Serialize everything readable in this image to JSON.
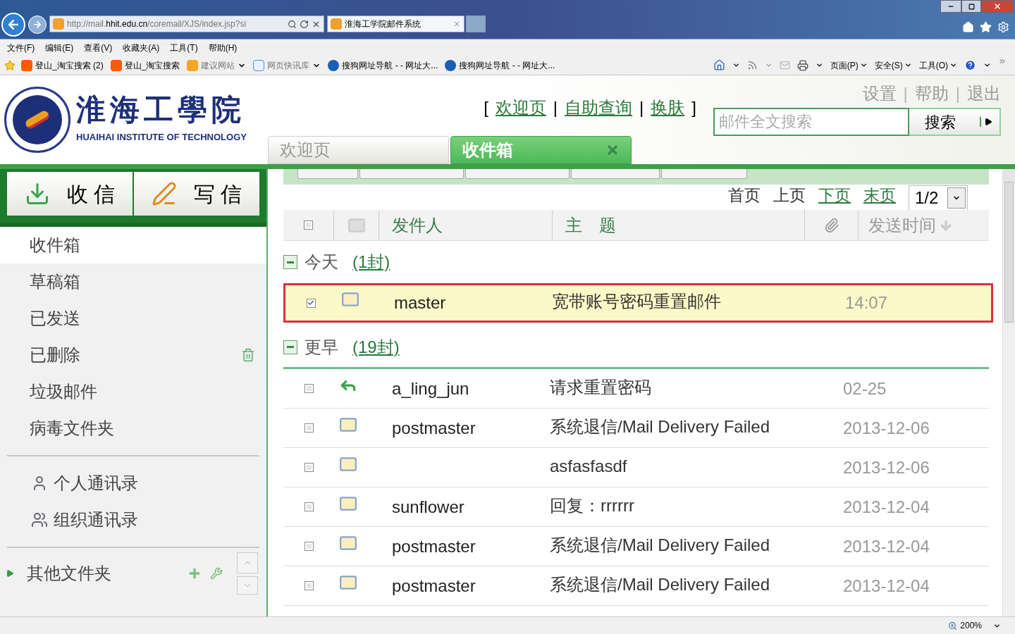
{
  "browser": {
    "address": "http://mail.**hhit.edu.cn**/coremail/XJS/index.jsp?si",
    "tab_title": "淮海工学院邮件系统",
    "menu": [
      "文件(F)",
      "编辑(E)",
      "查看(V)",
      "收藏夹(A)",
      "工具(T)",
      "帮助(H)"
    ],
    "favorites": [
      {
        "kind": "taobao",
        "label": "登山_淘宝搜索 (2)",
        "dropdown": false
      },
      {
        "kind": "taobao",
        "label": "登山_淘宝搜索",
        "dropdown": false
      },
      {
        "kind": "bing",
        "label": "建议网站",
        "dropdown": true
      },
      {
        "kind": "ie",
        "label": "网页快讯库",
        "dropdown": true
      },
      {
        "kind": "sogou",
        "label": "搜狗网址导航 - - 网址大...",
        "dropdown": false
      },
      {
        "kind": "sogou",
        "label": "搜狗网址导航 - - 网址大...",
        "dropdown": false
      }
    ],
    "commands": [
      "页面(P)",
      "安全(S)",
      "工具(O)"
    ],
    "zoom": "200%"
  },
  "header": {
    "logo_title": "淮海工學院",
    "logo_subtitle": "HUAIHAI INSTITUTE OF TECHNOLOGY",
    "top_links": [
      {
        "kind": "punct",
        "text": "["
      },
      {
        "kind": "link",
        "text": "欢迎页"
      },
      {
        "kind": "punct",
        "text": "|"
      },
      {
        "kind": "link",
        "text": "自助查询"
      },
      {
        "kind": "punct",
        "text": "|"
      },
      {
        "kind": "link",
        "text": "换肤"
      },
      {
        "kind": "punct",
        "text": "]"
      }
    ],
    "user_links": [
      {
        "kind": "link",
        "text": "设置"
      },
      {
        "kind": "punct",
        "text": "|"
      },
      {
        "kind": "link",
        "text": "帮助"
      },
      {
        "kind": "punct",
        "text": "|"
      },
      {
        "kind": "link",
        "text": "退出"
      }
    ],
    "search": {
      "placeholder": "邮件全文搜索",
      "button": "搜索"
    },
    "tabs": [
      {
        "label": "欢迎页",
        "selected": false
      },
      {
        "label": "收件箱",
        "selected": true
      }
    ]
  },
  "sidebar": {
    "actions": [
      {
        "kind": "receive",
        "label": "收 信"
      },
      {
        "kind": "compose",
        "label": "写 信"
      }
    ],
    "folders": [
      {
        "label": "收件箱",
        "selected": true,
        "action_icon": false
      },
      {
        "label": "草稿箱",
        "selected": false,
        "action_icon": false
      },
      {
        "label": "已发送",
        "selected": false,
        "action_icon": false
      },
      {
        "label": "已删除",
        "selected": false,
        "action_icon": true
      },
      {
        "label": "垃圾邮件",
        "selected": false,
        "action_icon": false
      },
      {
        "label": "病毒文件夹",
        "selected": false,
        "action_icon": false
      }
    ],
    "contacts": [
      {
        "kind": "personal",
        "label": "个人通讯录"
      },
      {
        "kind": "group",
        "label": "组织通讯录"
      }
    ],
    "other_folders": {
      "label": "其他文件夹",
      "expanded": false
    }
  },
  "mail_list": {
    "pager": [
      {
        "label": "首页",
        "disabled": true
      },
      {
        "label": "上页",
        "disabled": true
      },
      {
        "label": "下页",
        "disabled": false
      },
      {
        "label": "末页",
        "disabled": false
      }
    ],
    "page": "1/2",
    "select_all": false,
    "columns": {
      "sender": "发件人",
      "subject": "主　题",
      "time": "发送时间"
    },
    "groups": [
      {
        "label": "今天",
        "count": "(1封)",
        "expanded": true,
        "messages": [
          {
            "kind": "unread",
            "sender": "master",
            "subject": "宽带账号密码重置邮件",
            "time": "14:07",
            "checked": true,
            "selected": true
          }
        ]
      },
      {
        "label": "更早",
        "count": "(19封)",
        "expanded": true,
        "messages": [
          {
            "kind": "replied",
            "sender": "a_ling_jun",
            "subject": "请求重置密码",
            "time": "02-25",
            "checked": false,
            "selected": false
          },
          {
            "kind": "unread",
            "sender": "postmaster",
            "subject": "系统退信/Mail Delivery Failed",
            "time": "2013-12-06",
            "checked": false,
            "selected": false
          },
          {
            "kind": "unread",
            "subject": "asfasfasdf",
            "time": "2013-12-06",
            "checked": false,
            "selected": false
          },
          {
            "kind": "unread",
            "sender": "sunflower",
            "subject": "回复：rrrrrr",
            "time": "2013-12-04",
            "checked": false,
            "selected": false
          },
          {
            "kind": "unread",
            "sender": "postmaster",
            "subject": "系统退信/Mail Delivery Failed",
            "time": "2013-12-04",
            "checked": false,
            "selected": false
          },
          {
            "kind": "unread",
            "sender": "postmaster",
            "subject": "系统退信/Mail Delivery Failed",
            "time": "2013-12-04",
            "checked": false,
            "selected": false
          }
        ]
      }
    ]
  }
}
